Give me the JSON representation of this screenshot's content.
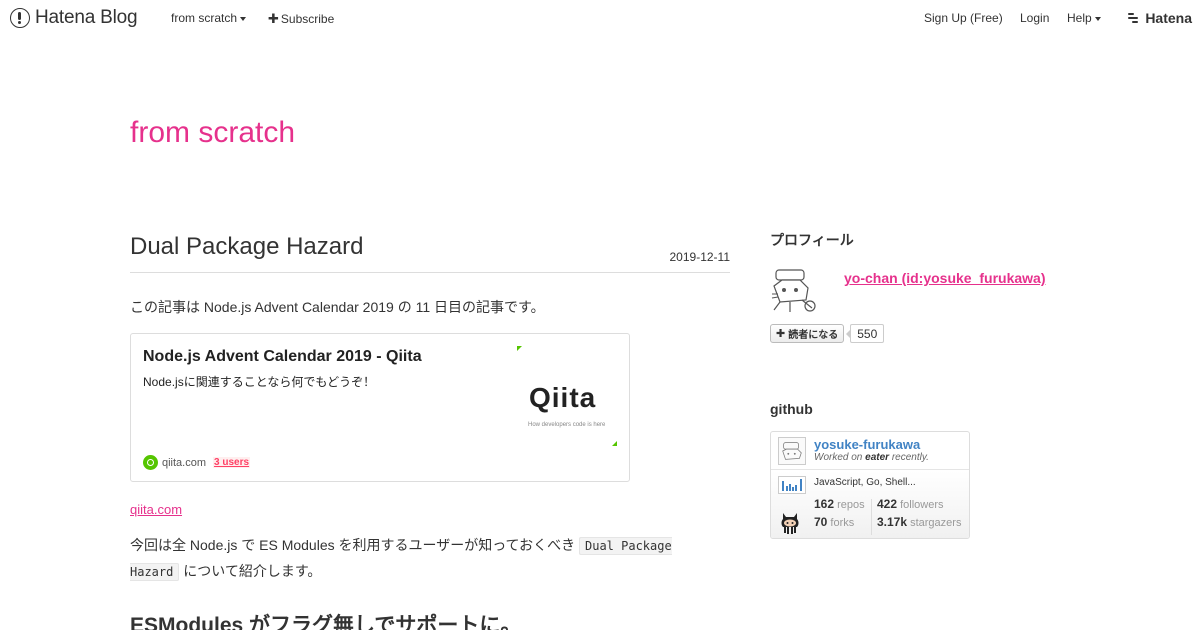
{
  "globalheader": {
    "logo_text": "Hatena Blog",
    "blog_menu": "from scratch",
    "subscribe": "Subscribe",
    "signup": "Sign Up (Free)",
    "login": "Login",
    "help": "Help",
    "hatena": "Hatena"
  },
  "blog": {
    "title": "from scratch"
  },
  "entry": {
    "title": "Dual Package Hazard",
    "date": "2019-12-11",
    "intro": "この記事は Node.js Advent Calendar 2019 の 11 日目の記事です。",
    "card": {
      "title": "Node.js Advent Calendar 2019 - Qiita",
      "description": "Node.jsに関連することなら何でもどうぞ！",
      "thumb_logo": "Qiita",
      "thumb_tagline": "How developers code is here",
      "domain": "qiita.com",
      "users": "3 users"
    },
    "source_link": "qiita.com",
    "p2_before": "今回は全 Node.js で ES Modules を利用するユーザーが知っておくべき ",
    "p2_code": "Dual Package Hazard",
    "p2_after": " について紹介します。",
    "h2": "ESModules がフラグ無しでサポートに。"
  },
  "sidebar": {
    "profile_heading": "プロフィール",
    "profile_name": "yo-chan (id:yosuke_furukawa)",
    "subscribe_label": "読者になる",
    "subscriber_count": "550",
    "github_heading": "github",
    "github": {
      "user": "yosuke-furukawa",
      "worked_prefix": "Worked on ",
      "worked_repo": "eater",
      "worked_suffix": " recently.",
      "languages": "JavaScript, Go, Shell...",
      "repos_count": "162",
      "repos_label": "repos",
      "followers_count": "422",
      "followers_label": "followers",
      "forks_count": "70",
      "forks_label": "forks",
      "stargazers_count": "3.17k",
      "stargazers_label": "stargazers"
    }
  }
}
